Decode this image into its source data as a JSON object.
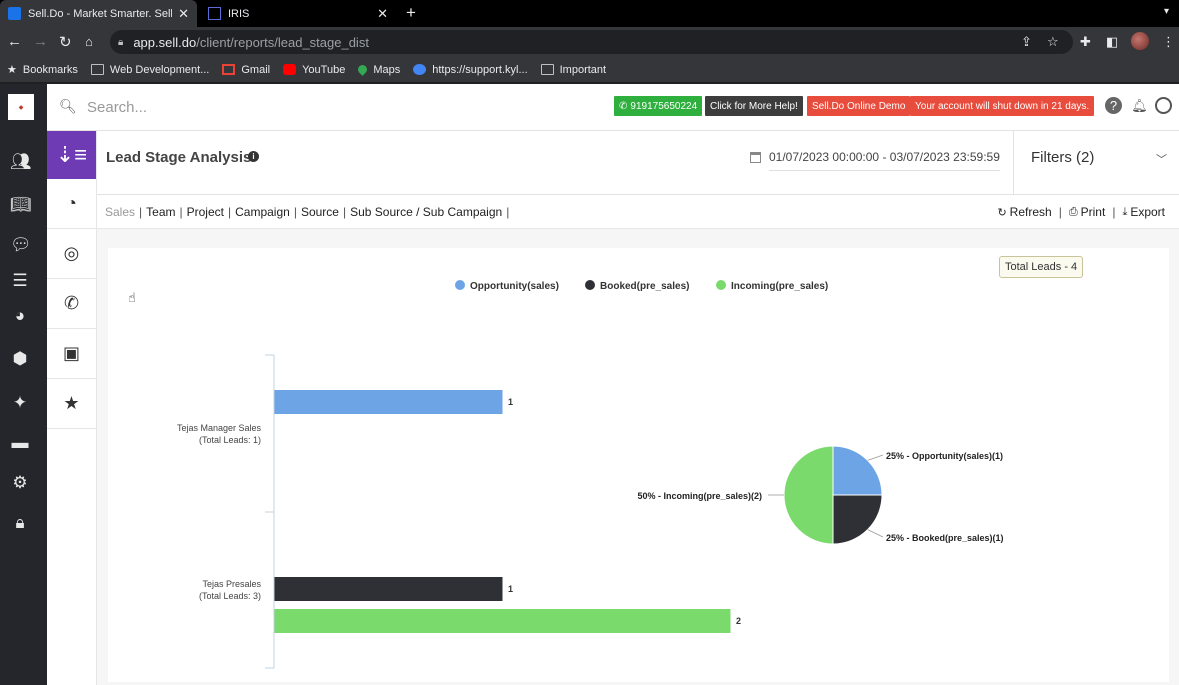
{
  "browser": {
    "tabs": [
      {
        "title": "Sell.Do - Market Smarter. Sell I",
        "active": true
      },
      {
        "title": "IRIS",
        "active": false
      }
    ],
    "url_host": "app.sell.do",
    "url_path": "/client/reports/lead_stage_dist",
    "bookmarks": [
      "Bookmarks",
      "Web Development...",
      "Gmail",
      "YouTube",
      "Maps",
      "https://support.kyl...",
      "Important"
    ]
  },
  "topbar": {
    "search_placeholder": "Search...",
    "phone": "919175650224",
    "help": "Click for More Help!",
    "demo": "Sell.Do Online Demo",
    "warning": "Your account will shut down in 21 days."
  },
  "header": {
    "title": "Lead Stage Analysis",
    "date_range": "01/07/2023 00:00:00 - 03/07/2023 23:59:59",
    "filters": "Filters (2)"
  },
  "report_tabs": [
    "Sales",
    "Team",
    "Project",
    "Campaign",
    "Source",
    "Sub Source / Sub Campaign"
  ],
  "actions": [
    "Refresh",
    "Print",
    "Export"
  ],
  "total_leads": "Total Leads - 4",
  "colors": {
    "opportunity": "#6da4e6",
    "booked": "#2f3036",
    "incoming": "#7bda6c",
    "accent": "#6e3bb4"
  },
  "chart_data": [
    {
      "type": "bar",
      "orientation": "horizontal",
      "categories": [
        {
          "name": "Tejas Manager Sales",
          "sub": "(Total Leads: 1)"
        },
        {
          "name": "Tejas Presales",
          "sub": "(Total Leads: 3)"
        }
      ],
      "series": [
        {
          "name": "Opportunity(sales)",
          "values": [
            1,
            0
          ]
        },
        {
          "name": "Booked(pre_sales)",
          "values": [
            0,
            1
          ]
        },
        {
          "name": "Incoming(pre_sales)",
          "values": [
            0,
            2
          ]
        }
      ],
      "xlim": [
        0,
        2
      ],
      "legend": "top-center"
    },
    {
      "type": "pie",
      "slices": [
        {
          "label": "25% - Opportunity(sales)(1)",
          "value": 1
        },
        {
          "label": "25% - Booked(pre_sales)(1)",
          "value": 1
        },
        {
          "label": "50% - Incoming(pre_sales)(2)",
          "value": 2
        }
      ]
    }
  ]
}
